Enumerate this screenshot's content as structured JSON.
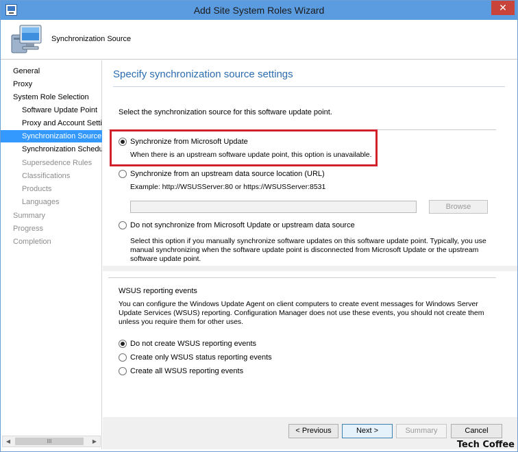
{
  "window": {
    "title": "Add Site System Roles Wizard",
    "close_label": "✕"
  },
  "header": {
    "title": "Synchronization Source"
  },
  "sidebar": {
    "items": [
      {
        "label": "General",
        "level": "top",
        "state": "normal"
      },
      {
        "label": "Proxy",
        "level": "top",
        "state": "normal"
      },
      {
        "label": "System Role Selection",
        "level": "top",
        "state": "normal"
      },
      {
        "label": "Software Update Point",
        "level": "sub",
        "state": "normal"
      },
      {
        "label": "Proxy and Account Settin",
        "level": "sub",
        "state": "normal"
      },
      {
        "label": "Synchronization Source",
        "level": "sub",
        "state": "selected"
      },
      {
        "label": "Synchronization Schedule",
        "level": "sub",
        "state": "normal"
      },
      {
        "label": "Supersedence Rules",
        "level": "sub",
        "state": "disabled"
      },
      {
        "label": "Classifications",
        "level": "sub",
        "state": "disabled"
      },
      {
        "label": "Products",
        "level": "sub",
        "state": "disabled"
      },
      {
        "label": "Languages",
        "level": "sub",
        "state": "disabled"
      },
      {
        "label": "Summary",
        "level": "top",
        "state": "disabled"
      },
      {
        "label": "Progress",
        "level": "top",
        "state": "disabled"
      },
      {
        "label": "Completion",
        "level": "top",
        "state": "disabled"
      }
    ],
    "scroll_left": "◀",
    "scroll_right": "▶",
    "scroll_grip": "III"
  },
  "main": {
    "page_title": "Specify synchronization source settings",
    "intro": "Select the synchronization source for this software update point.",
    "options": [
      {
        "label": "Synchronize from Microsoft Update",
        "desc": "When there is an upstream software update point, this option is unavailable.",
        "checked": true
      },
      {
        "label": "Synchronize from an upstream data source location (URL)",
        "desc": "Example: http://WSUSServer:80 or https://WSUSServer:8531",
        "checked": false
      },
      {
        "label": "Do not synchronize from Microsoft Update or upstream data source",
        "desc": "Select this option if you manually synchronize software updates on this software update point. Typically, you use manual synchronizing when the software update point is disconnected from Microsoft Update or the upstream software update point.",
        "checked": false
      }
    ],
    "url_value": "",
    "browse_label": "Browse",
    "wsus": {
      "title": "WSUS reporting events",
      "desc": "You can configure the Windows Update Agent on client computers to create event messages for Windows Server Update Services (WSUS) reporting. Configuration Manager does not use these events, you should not create them unless you require them for other uses.",
      "options": [
        {
          "label": "Do not create WSUS reporting events",
          "checked": true
        },
        {
          "label": "Create only WSUS status reporting events",
          "checked": false
        },
        {
          "label": "Create all WSUS reporting events",
          "checked": false
        }
      ]
    }
  },
  "footer": {
    "previous": "< Previous",
    "next": "Next >",
    "summary": "Summary",
    "cancel": "Cancel"
  },
  "watermark": "Tech Coffee",
  "colors": {
    "title_bar": "#5b9be0",
    "selected_nav": "#3399ff",
    "highlight_box": "#d0202a",
    "page_title": "#2b6cb0"
  }
}
